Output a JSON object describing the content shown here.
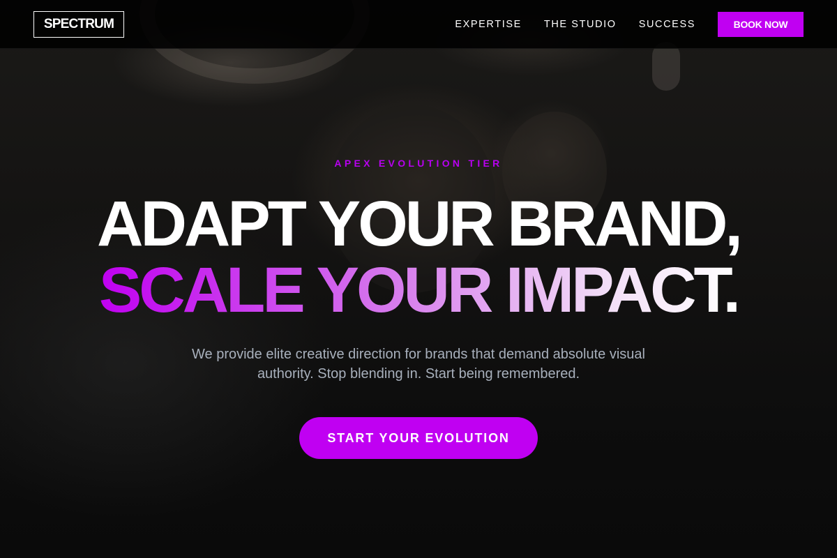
{
  "header": {
    "logo": "SPECTRUM",
    "nav": [
      {
        "label": "EXPERTISE"
      },
      {
        "label": "THE STUDIO"
      },
      {
        "label": "SUCCESS"
      }
    ],
    "book_label": "BOOK NOW"
  },
  "hero": {
    "eyebrow": "APEX EVOLUTION TIER",
    "headline_line1": "ADAPT YOUR BRAND,",
    "headline_line2": "SCALE YOUR IMPACT.",
    "subtitle": "We provide elite creative direction for brands that demand absolute visual authority. Stop blending in. Start being remembered.",
    "cta_label": "START YOUR EVOLUTION"
  },
  "colors": {
    "accent": "#c000f2",
    "background": "#0b0b0b",
    "subtitle_text": "#a8b0bc"
  }
}
